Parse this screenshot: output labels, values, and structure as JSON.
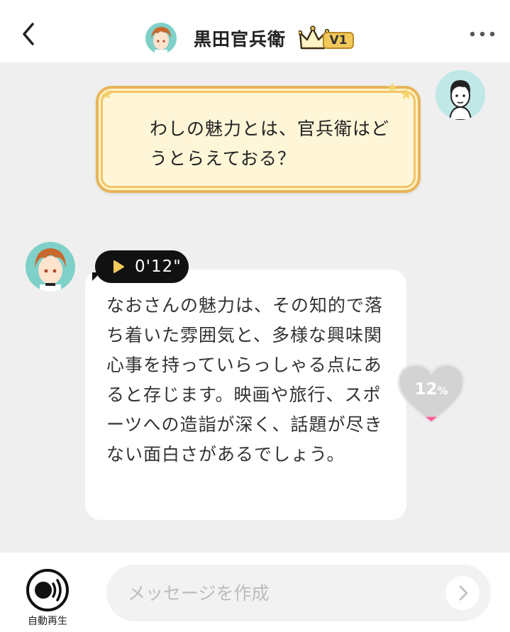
{
  "header": {
    "title": "黒田官兵衛",
    "rank_badge": "V1",
    "back_icon": "chevron-left-icon",
    "more_icon": "more-horizontal-icon"
  },
  "messages": [
    {
      "sender": "user",
      "text": "わしの魅力とは、官兵衛はどうとらえておる？"
    },
    {
      "sender": "character",
      "voice_duration": "0'12\"",
      "text": "なおさんの魅力は、その知的で落ち着いた雰囲気と、多様な興味関心事を持っていらっしゃる点にあると存じます。映画や旅行、スポーツへの造詣が深く、話題が尽きない面白さがあるでしょう。"
    }
  ],
  "affinity": {
    "value": "12",
    "unit": "%",
    "fraction": 0.12
  },
  "footer": {
    "autoplay_label": "自動再生",
    "input_placeholder": "メッセージを作成",
    "input_value": ""
  },
  "colors": {
    "background": "#efefef",
    "user_bubble_border": "#e8b45a",
    "user_bubble_fill": "#fff6d8",
    "heart_fill": "#ff5a9a",
    "voice_pill": "#111111"
  }
}
